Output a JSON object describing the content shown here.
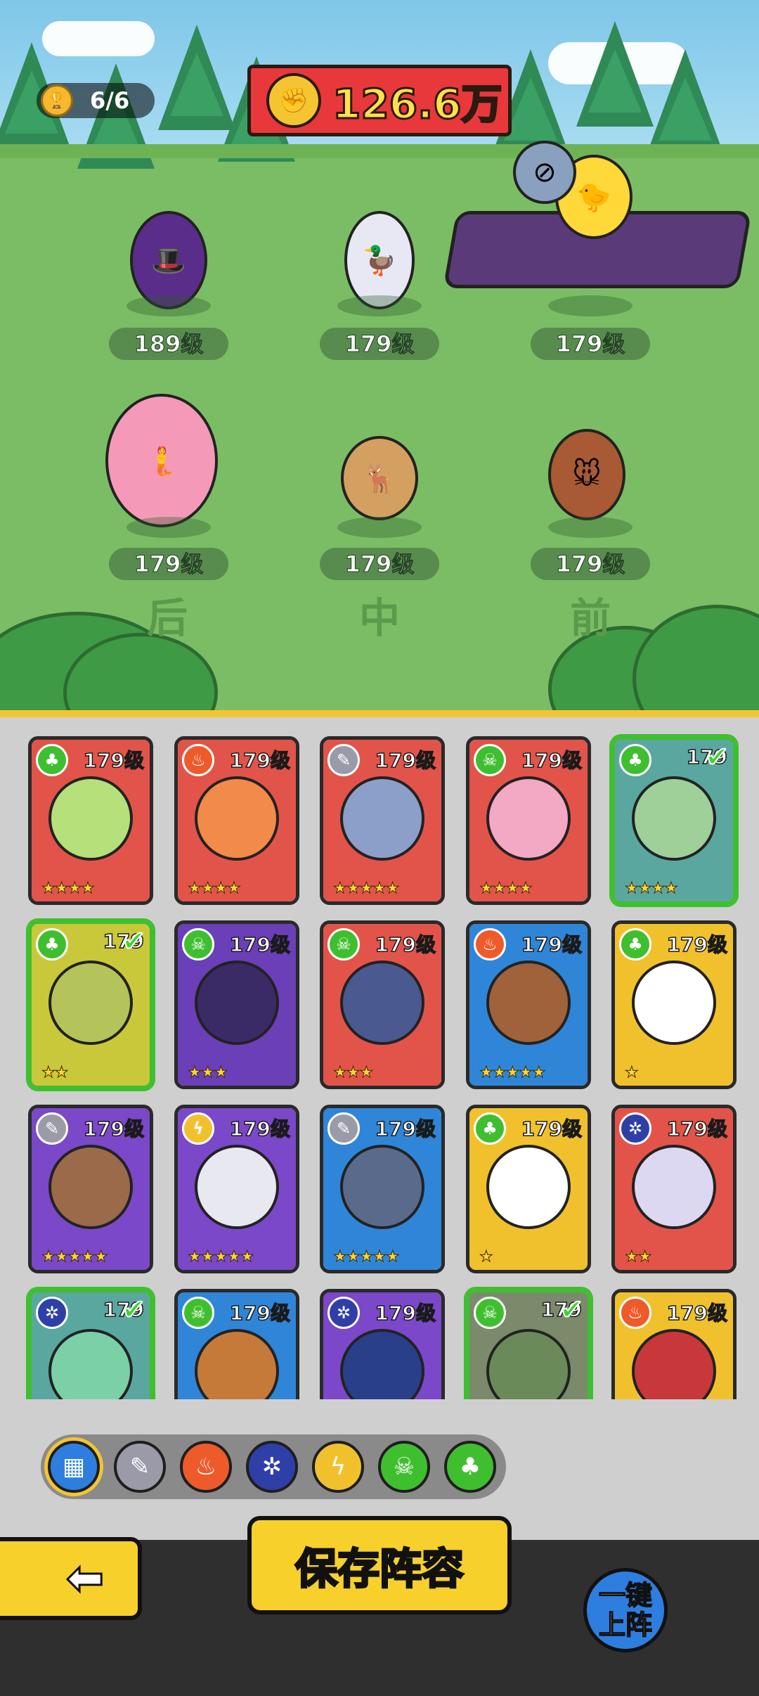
{
  "header": {
    "team_count": "6/6",
    "power_value": "126.6万"
  },
  "formation": {
    "slots": [
      {
        "level": "189级"
      },
      {
        "level": "179级"
      },
      {
        "level": "179级"
      },
      {
        "level": "179级"
      },
      {
        "level": "179级"
      },
      {
        "level": "179级"
      }
    ],
    "row_labels": [
      "后",
      "中",
      "前"
    ]
  },
  "roster": {
    "cards": [
      {
        "level": "179级",
        "element": "nature",
        "stars": "★★★★",
        "bg": "#e2544a",
        "face": "#b6e07a",
        "selected": false
      },
      {
        "level": "179级",
        "element": "fire",
        "stars": "★★★★",
        "bg": "#e2544a",
        "face": "#f28a4a",
        "selected": false
      },
      {
        "level": "179级",
        "element": "blade",
        "stars": "★★★★★",
        "bg": "#e2544a",
        "face": "#8c9fc9",
        "selected": false
      },
      {
        "level": "179级",
        "element": "poison",
        "stars": "★★★★",
        "bg": "#e2544a",
        "face": "#f3a8c4",
        "selected": false
      },
      {
        "level": "179",
        "element": "nature",
        "stars": "★★★★",
        "bg": "#5aa7a0",
        "face": "#9fd09a",
        "selected": true
      },
      {
        "level": "179",
        "element": "nature",
        "stars": "★★",
        "bg": "#c9c83a",
        "face": "#b4c45a",
        "selected": true
      },
      {
        "level": "179级",
        "element": "poison",
        "stars": "★★★",
        "bg": "#6a3fb8",
        "face": "#3a2a66",
        "selected": false
      },
      {
        "level": "179级",
        "element": "poison",
        "stars": "★★★",
        "bg": "#e2544a",
        "face": "#4a5a90",
        "selected": false
      },
      {
        "level": "179级",
        "element": "fire",
        "stars": "★★★★★",
        "bg": "#2f86d8",
        "face": "#a0623a",
        "selected": false
      },
      {
        "level": "179级",
        "element": "nature",
        "stars": "★",
        "bg": "#f1c12d",
        "face": "#ffffff",
        "selected": false
      },
      {
        "level": "179级",
        "element": "blade",
        "stars": "★★★★★",
        "bg": "#7a48c8",
        "face": "#9a6a4a",
        "selected": false
      },
      {
        "level": "179级",
        "element": "lightning",
        "stars": "★★★★★",
        "bg": "#7a48c8",
        "face": "#e8e8f0",
        "selected": false
      },
      {
        "level": "179级",
        "element": "blade",
        "stars": "★★★★★",
        "bg": "#2f86d8",
        "face": "#5a6a8a",
        "selected": false
      },
      {
        "level": "179级",
        "element": "nature",
        "stars": "★",
        "bg": "#f1c12d",
        "face": "#ffffff",
        "selected": false
      },
      {
        "level": "179级",
        "element": "ice",
        "stars": "★★",
        "bg": "#e2544a",
        "face": "#dcd8f2",
        "selected": false
      },
      {
        "level": "179",
        "element": "ice",
        "stars": "",
        "bg": "#5aa7a0",
        "face": "#7bd0a8",
        "selected": true
      },
      {
        "level": "179级",
        "element": "poison",
        "stars": "",
        "bg": "#2f86d8",
        "face": "#c67a3a",
        "selected": false
      },
      {
        "level": "179级",
        "element": "ice",
        "stars": "",
        "bg": "#7a48c8",
        "face": "#2a3f8a",
        "selected": false
      },
      {
        "level": "179",
        "element": "poison",
        "stars": "",
        "bg": "#7a8a6a",
        "face": "#6a8a5a",
        "selected": true
      },
      {
        "level": "179级",
        "element": "fire",
        "stars": "",
        "bg": "#f1c12d",
        "face": "#c8383a",
        "selected": false
      }
    ]
  },
  "filters": [
    {
      "name": "all",
      "color": "#2e7ee0",
      "glyph": "▦",
      "active": true
    },
    {
      "name": "blade",
      "color": "#9a9aa8",
      "glyph": "✎",
      "active": false
    },
    {
      "name": "fire",
      "color": "#ee5a2a",
      "glyph": "♨",
      "active": false
    },
    {
      "name": "ice",
      "color": "#2e3fa8",
      "glyph": "✲",
      "active": false
    },
    {
      "name": "lightning",
      "color": "#f1c12d",
      "glyph": "ϟ",
      "active": false
    },
    {
      "name": "poison",
      "color": "#3fbf2f",
      "glyph": "☠",
      "active": false
    },
    {
      "name": "nature",
      "color": "#3fbf2f",
      "glyph": "♣",
      "active": false
    }
  ],
  "element_colors": {
    "fire": "#ee5a2a",
    "blade": "#9a9aa8",
    "ice": "#2e3fa8",
    "lightning": "#f1c12d",
    "poison": "#3fbf2f",
    "nature": "#3fbf2f"
  },
  "element_glyphs": {
    "fire": "♨",
    "blade": "✎",
    "ice": "✲",
    "lightning": "ϟ",
    "poison": "☠",
    "nature": "♣"
  },
  "buttons": {
    "save_label": "保存阵容",
    "auto_label_line1": "一键",
    "auto_label_line2": "上阵",
    "back_glyph": "⬅"
  }
}
